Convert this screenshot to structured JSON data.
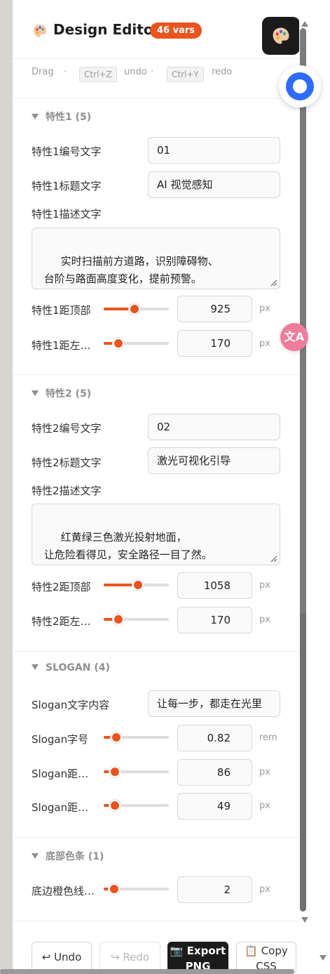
{
  "header": {
    "title": "Design Editor",
    "vars_badge": "46 vars"
  },
  "hint": {
    "drag": "Drag",
    "dot": "·",
    "undo_key": "Ctrl+Z",
    "undo": "undo",
    "redo_key": "Ctrl+Y",
    "redo": "redo"
  },
  "sections": {
    "f1": {
      "title": "特性1 (5)",
      "num_label": "特性1编号文字",
      "num_value": "01",
      "title_label": "特性1标题文字",
      "title_value": "AI 视觉感知",
      "desc_label": "特性1描述文字",
      "desc_value": "实时扫描前方道路，识别障碍物、\n 台阶与路面高度变化，提前预警。",
      "top_label": "特性1距顶部",
      "top_value": "925",
      "top_level": 0.47,
      "left_label": "特性1距左…",
      "left_value": "170",
      "left_level": 0.17,
      "unit": "px"
    },
    "f2": {
      "title": "特性2 (5)",
      "num_label": "特性2编号文字",
      "num_value": "02",
      "title_label": "特性2标题文字",
      "title_value": "激光可视化引导",
      "desc_label": "特性2描述文字",
      "desc_value": "红黄绿三色激光投射地面，\n 让危险看得见，安全路径一目了然。",
      "top_label": "特性2距顶部",
      "top_value": "1058",
      "top_level": 0.53,
      "left_label": "特性2距左…",
      "left_value": "170",
      "left_level": 0.17,
      "unit": "px"
    },
    "slogan": {
      "title": "SLOGAN (4)",
      "text_label": "Slogan文字内容",
      "text_value": "让每一步，都走在光里",
      "size_label": "Slogan字号",
      "size_value": "0.82",
      "size_unit": "rem",
      "size_level": 0.13,
      "pos1_label": "Slogan距…",
      "pos1_value": "86",
      "pos1_level": 0.11,
      "pos2_label": "Slogan距…",
      "pos2_value": "49",
      "pos2_level": 0.11,
      "unit": "px"
    },
    "bottom_bar": {
      "title": "底部色条 (1)",
      "line_label": "底边橙色线…",
      "line_value": "2",
      "line_level": 0.09,
      "unit": "px"
    }
  },
  "footer": {
    "undo": "↩ Undo",
    "redo": "↪ Redo",
    "export_line1": "📷 Export",
    "export_line2": "PNG",
    "copy_line1": "📋 Copy",
    "copy_line2": "CSS"
  },
  "colors": {
    "accent": "#e9541f",
    "dark": "#1b1b1b",
    "assistant_blue": "#2f6bff",
    "translate_pink": "#ef7d9a"
  },
  "icons": [
    "palette-icon",
    "assistant-icon",
    "translate-icon"
  ]
}
